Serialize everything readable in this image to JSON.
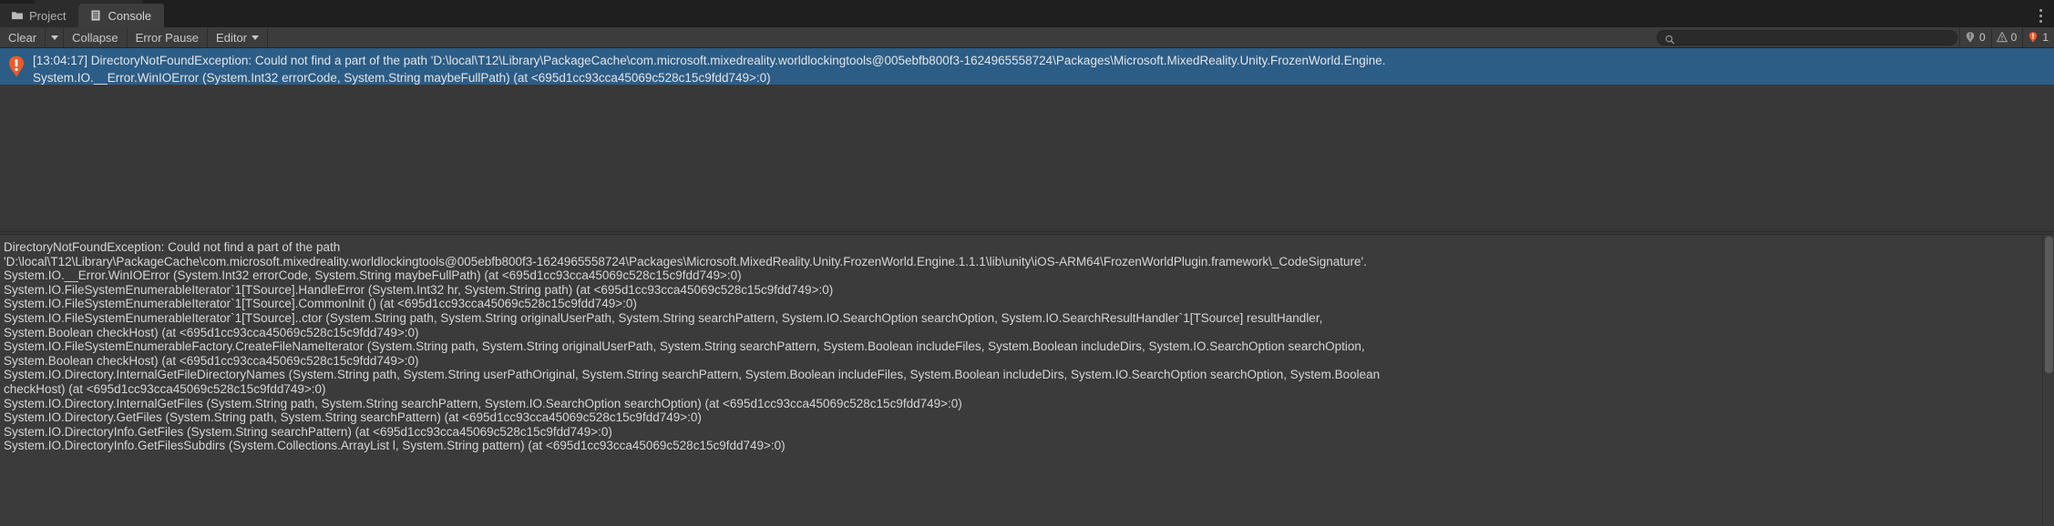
{
  "window": {
    "tabs": [
      {
        "label": "Project",
        "icon": "folder-icon",
        "active": false
      },
      {
        "label": "Console",
        "icon": "console-icon",
        "active": true
      }
    ],
    "menu_icon": "kebab-menu-icon"
  },
  "toolbar": {
    "clear_label": "Clear",
    "clear_dropdown_icon": "chevron-down-icon",
    "collapse_label": "Collapse",
    "error_pause_label": "Error Pause",
    "editor_label": "Editor",
    "editor_dropdown_icon": "chevron-down-icon",
    "search": {
      "icon": "search-icon",
      "value": "",
      "placeholder": ""
    },
    "counters": {
      "info": {
        "icon": "info-icon",
        "count": "0"
      },
      "warning": {
        "icon": "warning-icon",
        "count": "0"
      },
      "error": {
        "icon": "error-icon",
        "count": "1"
      }
    }
  },
  "log_list": {
    "entries": [
      {
        "icon": "error-icon",
        "selected": true,
        "line1": "[13:04:17] DirectoryNotFoundException: Could not find a part of the path 'D:\\local\\T12\\Library\\PackageCache\\com.microsoft.mixedreality.worldlockingtools@005ebfb800f3-1624965558724\\Packages\\Microsoft.MixedReality.Unity.FrozenWorld.Engine.",
        "line2": "System.IO.__Error.WinIOError (System.Int32 errorCode, System.String maybeFullPath) (at <695d1cc93cca45069c528c15c9fdd749>:0)"
      }
    ]
  },
  "detail": {
    "colors": {
      "accent_selection": "#2c5d87",
      "error": "#f05a28"
    },
    "lines": [
      "DirectoryNotFoundException: Could not find a part of the path",
      "'D:\\local\\T12\\Library\\PackageCache\\com.microsoft.mixedreality.worldlockingtools@005ebfb800f3-1624965558724\\Packages\\Microsoft.MixedReality.Unity.FrozenWorld.Engine.1.1.1\\lib\\unity\\iOS-ARM64\\FrozenWorldPlugin.framework\\_CodeSignature'.",
      "System.IO.__Error.WinIOError (System.Int32 errorCode, System.String maybeFullPath) (at <695d1cc93cca45069c528c15c9fdd749>:0)",
      "System.IO.FileSystemEnumerableIterator`1[TSource].HandleError (System.Int32 hr, System.String path) (at <695d1cc93cca45069c528c15c9fdd749>:0)",
      "System.IO.FileSystemEnumerableIterator`1[TSource].CommonInit () (at <695d1cc93cca45069c528c15c9fdd749>:0)",
      "System.IO.FileSystemEnumerableIterator`1[TSource]..ctor (System.String path, System.String originalUserPath, System.String searchPattern, System.IO.SearchOption searchOption, System.IO.SearchResultHandler`1[TSource] resultHandler,",
      "System.Boolean checkHost) (at <695d1cc93cca45069c528c15c9fdd749>:0)",
      "System.IO.FileSystemEnumerableFactory.CreateFileNameIterator (System.String path, System.String originalUserPath, System.String searchPattern, System.Boolean includeFiles, System.Boolean includeDirs, System.IO.SearchOption searchOption,",
      "System.Boolean checkHost) (at <695d1cc93cca45069c528c15c9fdd749>:0)",
      "System.IO.Directory.InternalGetFileDirectoryNames (System.String path, System.String userPathOriginal, System.String searchPattern, System.Boolean includeFiles, System.Boolean includeDirs, System.IO.SearchOption searchOption, System.Boolean",
      "checkHost) (at <695d1cc93cca45069c528c15c9fdd749>:0)",
      "System.IO.Directory.InternalGetFiles (System.String path, System.String searchPattern, System.IO.SearchOption searchOption) (at <695d1cc93cca45069c528c15c9fdd749>:0)",
      "System.IO.Directory.GetFiles (System.String path, System.String searchPattern) (at <695d1cc93cca45069c528c15c9fdd749>:0)",
      "System.IO.DirectoryInfo.GetFiles (System.String searchPattern) (at <695d1cc93cca45069c528c15c9fdd749>:0)",
      "System.IO.DirectoryInfo.GetFilesSubdirs (System.Collections.ArrayList l, System.String pattern) (at <695d1cc93cca45069c528c15c9fdd749>:0)"
    ]
  }
}
